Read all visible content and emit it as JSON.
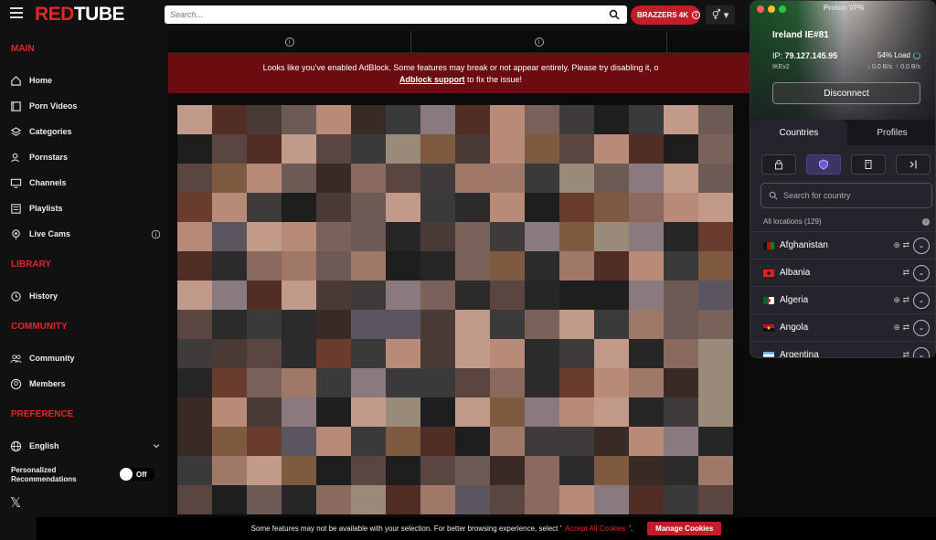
{
  "header": {
    "logo_red": "RED",
    "logo_white": "TUBE",
    "search_placeholder": "Search...",
    "brazzers_label": "BRAZZERS 4K",
    "gender_symbol": "⚥ ▾"
  },
  "sidebar": {
    "main_label": "MAIN",
    "main_items": [
      {
        "label": "Home",
        "icon": "home-icon"
      },
      {
        "label": "Porn Videos",
        "icon": "video-icon"
      },
      {
        "label": "Categories",
        "icon": "layers-icon"
      },
      {
        "label": "Pornstars",
        "icon": "star-person-icon"
      },
      {
        "label": "Channels",
        "icon": "monitor-icon"
      },
      {
        "label": "Playlists",
        "icon": "playlist-icon"
      },
      {
        "label": "Live Cams",
        "icon": "live-cam-icon"
      }
    ],
    "library_label": "LIBRARY",
    "library_items": [
      {
        "label": "History",
        "icon": "history-icon"
      }
    ],
    "community_label": "COMMUNITY",
    "community_items": [
      {
        "label": "Community",
        "icon": "community-icon"
      },
      {
        "label": "Members",
        "icon": "members-icon"
      }
    ],
    "preference_label": "PREFERENCE",
    "language": "English",
    "personalized_line1": "Personalized",
    "personalized_line2": "Recommendations",
    "toggle_state": "Off"
  },
  "adblock": {
    "message": "Looks like you've enabled AdBlock. Some features may break or not appear entirely. Please try disabling it, o",
    "link": "Adblock support",
    "suffix": " to fix the issue!"
  },
  "cookie": {
    "text_before": "Some features may not be available with your selection. For better browsing experience, select '",
    "accept_link": "Accept All Cookies",
    "text_after": "'.",
    "manage_button": "Manage Cookies"
  },
  "vpn": {
    "title": "Proton VPN",
    "server": "Ireland IE#81",
    "ip_label": "IP:",
    "ip_value": "79.127.145.95",
    "load": "54% Load",
    "protocol": "IKEv2",
    "down_speed": "↓ 0.0 B/s",
    "up_speed": "↑ 0.0 B/s",
    "disconnect_label": "Disconnect",
    "tab_countries": "Countries",
    "tab_profiles": "Profiles",
    "search_placeholder": "Search for country",
    "all_locations": "All locations (129)",
    "countries": [
      {
        "name": "Afghanistan",
        "icons": "⊕ ⇄"
      },
      {
        "name": "Albania",
        "icons": "⇄"
      },
      {
        "name": "Algeria",
        "icons": "⊕ ⇄"
      },
      {
        "name": "Angola",
        "icons": "⊕ ⇄"
      },
      {
        "name": "Argentina",
        "icons": "⇄"
      }
    ]
  }
}
